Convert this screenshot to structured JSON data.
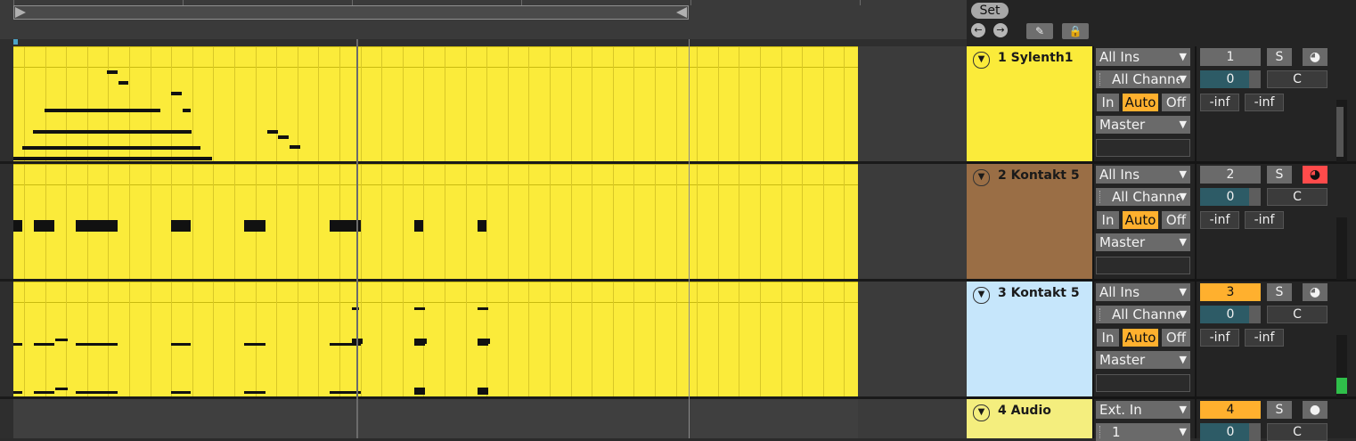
{
  "toolbar": {
    "set_label": "Set",
    "back_label": "←",
    "forward_label": "→",
    "draw_label": "✎",
    "lock_label": "🔒"
  },
  "colors": {
    "clip": "#fbeb3a",
    "track1": "#fbeb3a",
    "track2": "#9a6e45",
    "track3": "#c6e6fb",
    "track4": "#f4ee7e",
    "active": "#ffb02e",
    "arm": "#ff4b4b"
  },
  "tracks": [
    {
      "name": "1 Sylenth1",
      "input": "All Ins",
      "channel": "All Channe",
      "mon_in": "In",
      "mon_auto": "Auto",
      "mon_off": "Off",
      "output": "Master",
      "number": "1",
      "solo": "S",
      "arm": "◕",
      "volume": "0",
      "pan": "C",
      "peak_l": "-inf",
      "peak_r": "-inf"
    },
    {
      "name": "2 Kontakt 5",
      "input": "All Ins",
      "channel": "All Channe",
      "mon_in": "In",
      "mon_auto": "Auto",
      "mon_off": "Off",
      "output": "Master",
      "number": "2",
      "solo": "S",
      "arm": "◕",
      "volume": "0",
      "pan": "C",
      "peak_l": "-inf",
      "peak_r": "-inf"
    },
    {
      "name": "3 Kontakt 5",
      "input": "All Ins",
      "channel": "All Channe",
      "mon_in": "In",
      "mon_auto": "Auto",
      "mon_off": "Off",
      "output": "Master",
      "number": "3",
      "solo": "S",
      "arm": "◕",
      "volume": "0",
      "pan": "C",
      "peak_l": "-inf",
      "peak_r": "-inf"
    },
    {
      "name": "4 Audio",
      "input": "Ext. In",
      "channel": "1",
      "number": "4",
      "solo": "S",
      "arm": "●",
      "volume": "0",
      "pan": "C"
    }
  ],
  "icons": {
    "fold": "fold-triangle-icon",
    "dropdown": "chevron-down-icon"
  }
}
